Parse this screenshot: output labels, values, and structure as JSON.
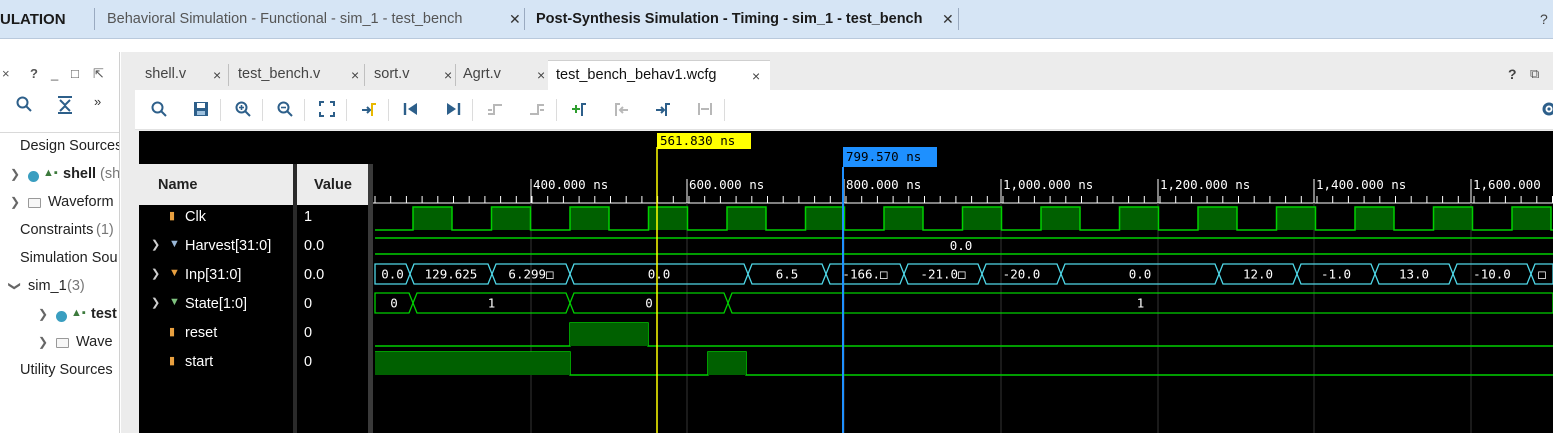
{
  "topbar": {
    "title": "ULATION",
    "tabs": [
      {
        "label": "Behavioral Simulation - Functional - sim_1 - test_bench",
        "active": false
      },
      {
        "label": "Post-Synthesis Simulation - Timing - sim_1 - test_bench",
        "active": true
      }
    ],
    "help": "?"
  },
  "left_panel": {
    "header_icons": {
      "close": "×",
      "help": "?",
      "minimize": "_",
      "restore": "□",
      "float": "⇱"
    },
    "toolbar": {
      "search": "search-icon",
      "collapse": "collapse-all-icon",
      "more": "»"
    },
    "tree": [
      {
        "label": "Design Sources",
        "level": 0,
        "expanded": true
      },
      {
        "label": "shell",
        "suffix": "(sh",
        "level": 1,
        "bold": true
      },
      {
        "label": "Waveform",
        "level": 1
      },
      {
        "label": "Constraints",
        "suffix": "(1)",
        "level": 0
      },
      {
        "label": "Simulation Sou",
        "level": 0,
        "expanded": true
      },
      {
        "label": "sim_1",
        "suffix": "(3)",
        "level": 1,
        "expanded": true
      },
      {
        "label": "test",
        "level": 2,
        "bold": true
      },
      {
        "label": "Wave",
        "level": 2
      },
      {
        "label": "Utility Sources",
        "level": 0
      }
    ]
  },
  "editor": {
    "tabs": [
      {
        "label": "shell.v",
        "active": false
      },
      {
        "label": "test_bench.v",
        "active": false
      },
      {
        "label": "sort.v",
        "active": false
      },
      {
        "label": "Agrt.v",
        "active": false
      },
      {
        "label": "test_bench_behav1.wcfg",
        "active": true
      }
    ],
    "close_glyph": "×",
    "help": "?",
    "toolbar_icons": [
      "search-icon",
      "save-icon",
      "zoom-in-icon",
      "zoom-out-icon",
      "zoom-fit-icon",
      "go-to-cursor-icon",
      "go-to-time-0-icon",
      "go-to-last-time-icon",
      "previous-transition-icon",
      "next-transition-icon",
      "add-marker-icon",
      "previous-marker-icon",
      "next-marker-icon",
      "swap-cursors-icon",
      "settings-icon"
    ]
  },
  "waveform": {
    "headers": {
      "name": "Name",
      "value": "Value"
    },
    "cursors": {
      "primary": "561.830 ns",
      "secondary": "799.570 ns"
    },
    "timeline_labels": [
      "400.000 ns",
      "600.000 ns",
      "800.000 ns",
      "1,000.000 ns",
      "1,200.000 ns",
      "1,400.000 ns",
      "1,600.000"
    ],
    "signals": [
      {
        "name": "Clk",
        "value": "1",
        "kind": "bit",
        "expandable": false
      },
      {
        "name": "Harvest[31:0]",
        "value": "0.0",
        "kind": "bus",
        "expandable": true
      },
      {
        "name": "Inp[31:0]",
        "value": "0.0",
        "kind": "bus",
        "expandable": true
      },
      {
        "name": "State[1:0]",
        "value": "0",
        "kind": "bus",
        "expandable": true
      },
      {
        "name": "reset",
        "value": "0",
        "kind": "bit",
        "expandable": false
      },
      {
        "name": "start",
        "value": "0",
        "kind": "bit",
        "expandable": false
      }
    ],
    "bus_labels": {
      "harvest": [
        "0.0"
      ],
      "inp": [
        "0.0",
        "129.625",
        "6.299□",
        "0.0",
        "6.5",
        "-166.□",
        "-21.0□",
        "-20.0",
        "0.0",
        "12.0",
        "-1.0",
        "13.0",
        "-10.0",
        "□"
      ],
      "state": [
        "0",
        "1",
        "0",
        "1"
      ]
    },
    "colors": {
      "wave": "#00d000",
      "bus": "#4fd8e8",
      "primary_cursor": "#ffff00",
      "secondary_cursor": "#1e90ff",
      "fill": "#006000"
    }
  }
}
